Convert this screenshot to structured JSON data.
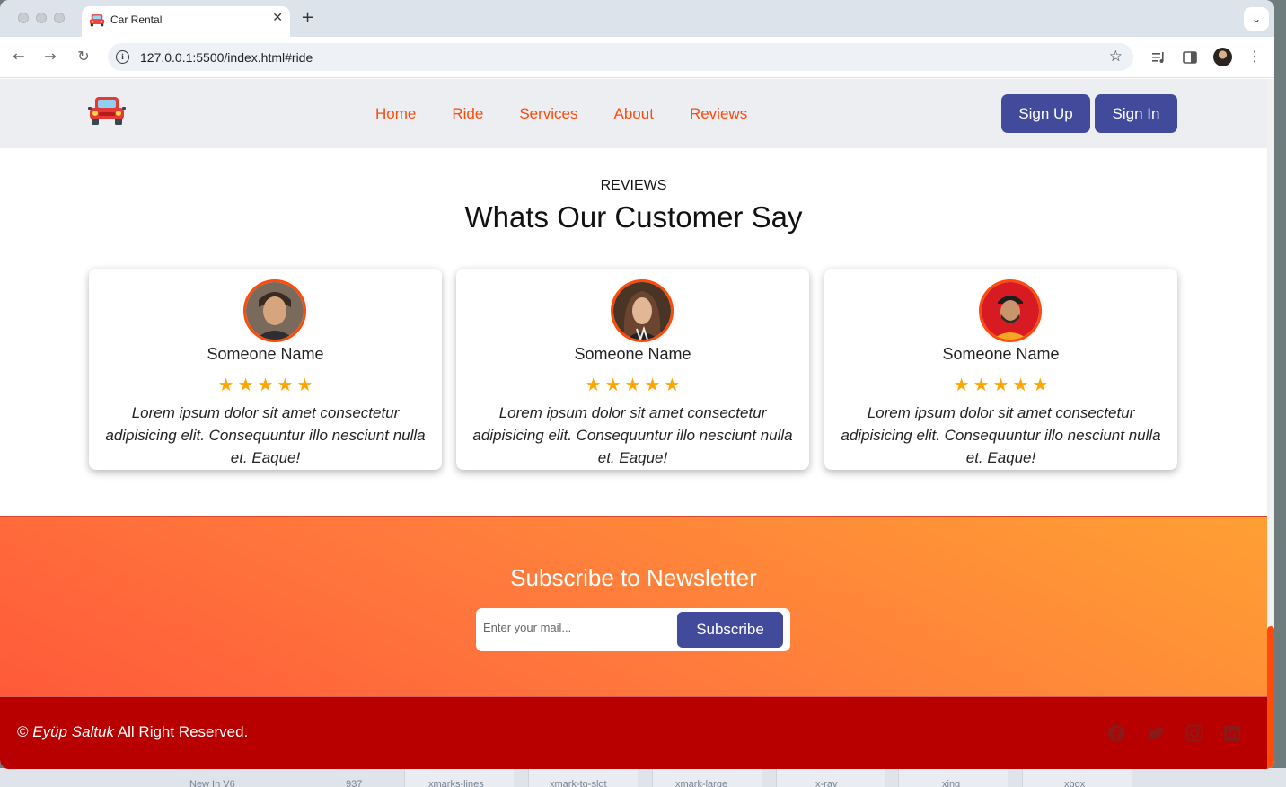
{
  "browser": {
    "tab_title": "Car Rental",
    "url": "127.0.0.1:5500/index.html#ride",
    "new_tab_symbol": "+",
    "close_symbol": "✕"
  },
  "header": {
    "nav": [
      "Home",
      "Ride",
      "Services",
      "About",
      "Reviews"
    ],
    "sign_up": "Sign Up",
    "sign_in": "Sign In"
  },
  "reviews": {
    "label": "REVIEWS",
    "title": "Whats Our Customer Say",
    "rating": 5,
    "cards": [
      {
        "name": "Someone Name",
        "text": "Lorem ipsum dolor sit amet consectetur adipisicing elit. Consequuntur illo nesciunt nulla et. Eaque!"
      },
      {
        "name": "Someone Name",
        "text": "Lorem ipsum dolor sit amet consectetur adipisicing elit. Consequuntur illo nesciunt nulla et. Eaque!"
      },
      {
        "name": "Someone Name",
        "text": "Lorem ipsum dolor sit amet consectetur adipisicing elit. Consequuntur illo nesciunt nulla et. Eaque!"
      }
    ]
  },
  "newsletter": {
    "title": "Subscribe to Newsletter",
    "placeholder": "Enter your mail...",
    "button": "Subscribe"
  },
  "footer": {
    "copyright_symbol": "©",
    "author": "Eyüp Saltuk",
    "rights": "All Right Reserved.",
    "social_icons": [
      "facebook-icon",
      "twitter-icon",
      "instagram-icon",
      "linkedin-icon"
    ]
  },
  "background_strip": [
    "New In V6",
    "937",
    "xmarks-lines",
    "xmark-to-slot",
    "xmark-large",
    "x-ray",
    "xing",
    "xbox"
  ],
  "colors": {
    "accent": "#ff4a0a",
    "button": "#424a9c",
    "footer": "#b80000",
    "star": "#ffa500"
  }
}
